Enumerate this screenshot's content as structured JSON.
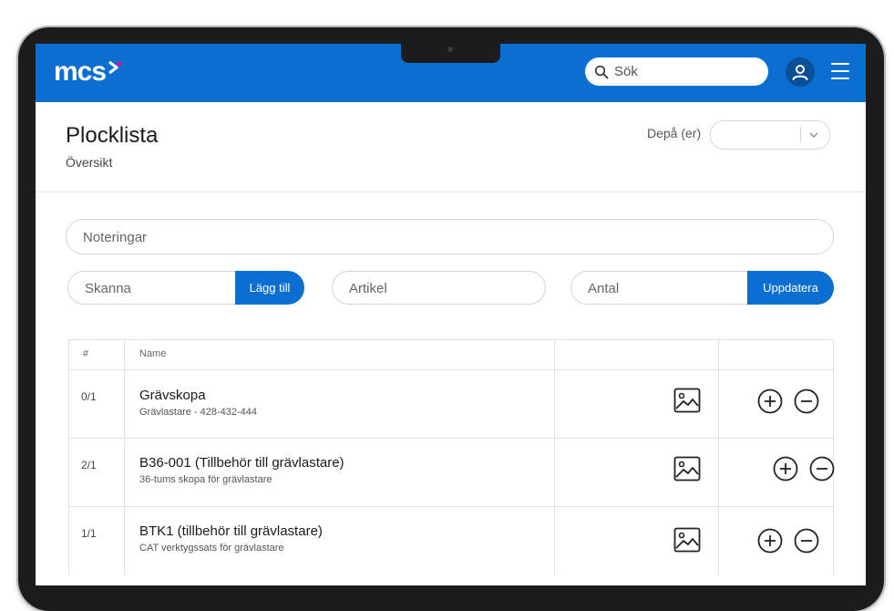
{
  "header": {
    "logo_text": "mcs",
    "search_placeholder": "Sök",
    "user_icon": "user-icon",
    "menu_icon": "hamburger-menu-icon"
  },
  "page": {
    "title": "Plocklista",
    "subtitle": "Översikt",
    "depot_label": "Depå (er)",
    "depot_value": ""
  },
  "form": {
    "notes_placeholder": "Noteringar",
    "scan_placeholder": "Skanna",
    "add_button": "Lägg till",
    "article_placeholder": "Artikel",
    "quantity_placeholder": "Antal",
    "update_button": "Uppdatera"
  },
  "table": {
    "columns": [
      "#",
      "Name",
      "",
      ""
    ],
    "rows": [
      {
        "count": "0/1",
        "name": "Grävskopa",
        "description": "Grävlastare - 428-432-444"
      },
      {
        "count": "2/1",
        "name": "B36-001 (Tillbehör till grävlastare)",
        "description": "36-tums skopa för grävlastare"
      },
      {
        "count": "1/1",
        "name": "BTK1 (tillbehör till grävlastare)",
        "description": "CAT verktygssats för grävlastare"
      }
    ]
  },
  "colors": {
    "brand_blue": "#0a6fd0",
    "accent_pink": "#e0148c",
    "device_frame": "#1c1c1e"
  }
}
